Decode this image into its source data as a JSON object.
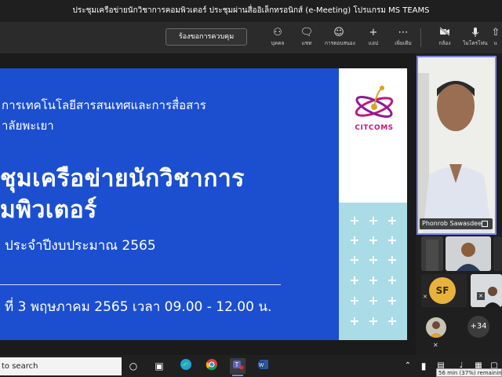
{
  "window": {
    "title": "ประชุมเครือข่ายนักวิชาการคอมพิวเตอร์ ประชุมผ่านสื่ออิเล็กทรอนิกส์ (e-Meeting) โปรแกรม MS TEAMS"
  },
  "toolbar": {
    "request_control": "ร้องขอการควบคุม",
    "buttons": [
      {
        "icon": "people-icon",
        "label": "บุคคล"
      },
      {
        "icon": "chat-icon",
        "label": "แชท"
      },
      {
        "icon": "reactions-icon",
        "label": "การตอบสนอง"
      },
      {
        "icon": "plus-icon",
        "label": "แอป"
      },
      {
        "icon": "more-icon",
        "label": "เพิ่มเติม"
      },
      {
        "icon": "camera-off-icon",
        "label": "กล้อง"
      },
      {
        "icon": "microphone-icon",
        "label": "ไมโครโฟน"
      },
      {
        "icon": "share-icon",
        "label": "แ"
      }
    ]
  },
  "slide": {
    "faculty_line1": "การเทคโนโลยีสารสนเทศและการสื่อสาร",
    "faculty_line2": "าลัยพะเยา",
    "title_line1": "ชุมเครือข่ายนักวิชาการ",
    "title_line2": "มพิวเตอร์",
    "fiscal_year": "ประจำปีงบประมาณ 2565",
    "date_time": "ที่ 3 พฤษภาคม 2565 เวลา 09.00 - 12.00 น.",
    "logo_text": "CITCOMS",
    "colors": {
      "blue": "#1c4fcf",
      "teal": "#a9dce6",
      "logo": "#c0197c"
    }
  },
  "participants": {
    "presenter_name": "Phonrob Sawasdee",
    "initials": "SF",
    "more_count": "+34"
  },
  "taskbar": {
    "search_text": "to search",
    "battery_tooltip": "56 min (37%) remaining"
  }
}
